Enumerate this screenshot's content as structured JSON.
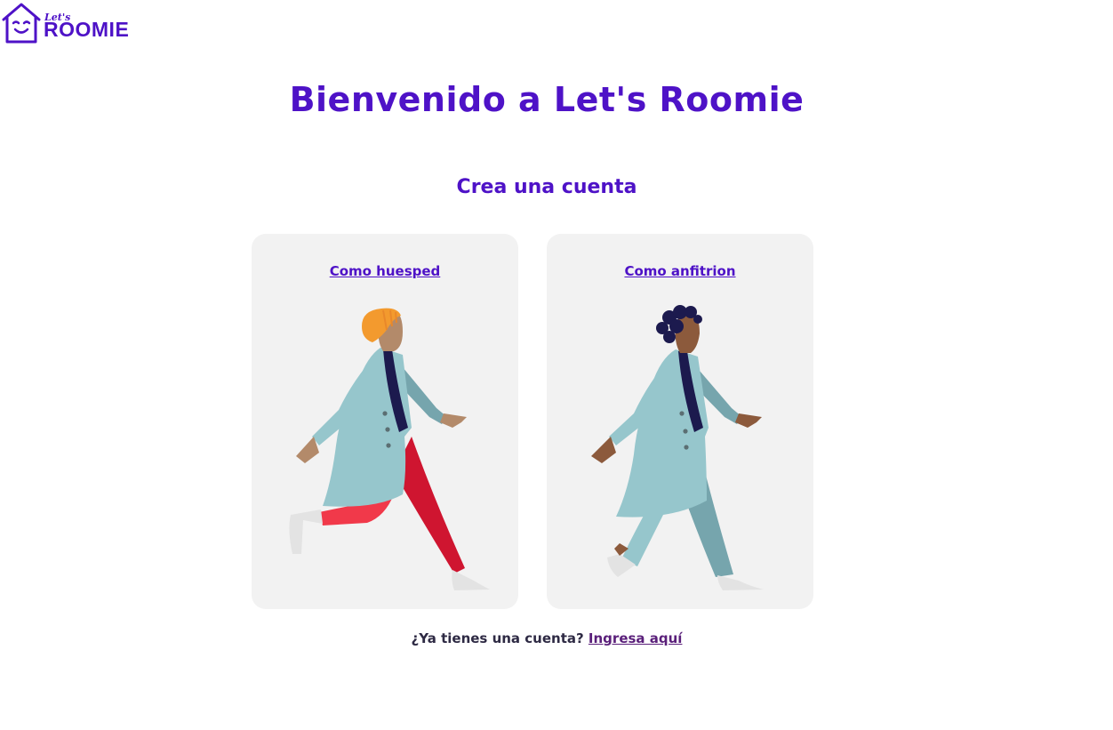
{
  "brand": {
    "lets": "Let's",
    "roomie": "ROOMIE",
    "color": "#4e12c7"
  },
  "header": {
    "title": "Bienvenido a Let's Roomie"
  },
  "main": {
    "subtitle": "Crea una cuenta",
    "cards": [
      {
        "label": "Como huesped",
        "illustration": "walking-person-guest-illustration"
      },
      {
        "label": "Como anfitrion",
        "illustration": "walking-person-host-illustration"
      }
    ]
  },
  "footer": {
    "question": "¿Ya tienes una cuenta?",
    "login_link": "Ingresa aquí"
  },
  "colors": {
    "accent": "#4e12c7",
    "card_bg": "#f2f2f2",
    "coat": "#96c6cc"
  }
}
